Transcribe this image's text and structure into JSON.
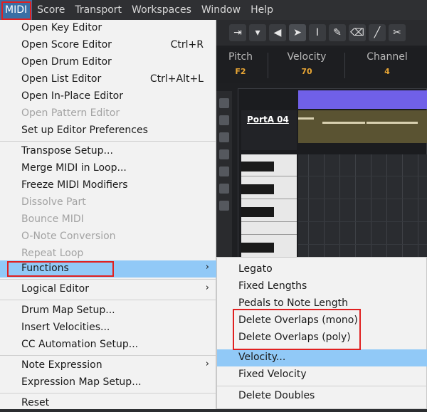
{
  "menubar": {
    "items": [
      "MIDI",
      "Score",
      "Transport",
      "Workspaces",
      "Window",
      "Help"
    ]
  },
  "infobar": {
    "pitch_label": "Pitch",
    "pitch_value": "F2",
    "velocity_label": "Velocity",
    "velocity_value": "70",
    "channel_label": "Channel",
    "channel_value": "4"
  },
  "track": {
    "name": "PortA 04"
  },
  "midi_menu": {
    "items": [
      {
        "label": "Open Key Editor",
        "shortcut": "",
        "disabled": false
      },
      {
        "label": "Open Score Editor",
        "shortcut": "Ctrl+R",
        "disabled": false
      },
      {
        "label": "Open Drum Editor",
        "shortcut": "",
        "disabled": false
      },
      {
        "label": "Open List Editor",
        "shortcut": "Ctrl+Alt+L",
        "disabled": false
      },
      {
        "label": "Open In-Place Editor",
        "shortcut": "",
        "disabled": false
      },
      {
        "label": "Open Pattern Editor",
        "shortcut": "",
        "disabled": true
      },
      {
        "label": "Set up Editor Preferences",
        "shortcut": "",
        "disabled": false
      },
      {
        "label": "Transpose Setup...",
        "shortcut": "",
        "disabled": false
      },
      {
        "label": "Merge MIDI in Loop...",
        "shortcut": "",
        "disabled": false
      },
      {
        "label": "Freeze MIDI Modifiers",
        "shortcut": "",
        "disabled": false
      },
      {
        "label": "Dissolve Part",
        "shortcut": "",
        "disabled": true
      },
      {
        "label": "Bounce MIDI",
        "shortcut": "",
        "disabled": true
      },
      {
        "label": "O-Note Conversion",
        "shortcut": "",
        "disabled": true
      },
      {
        "label": "Repeat Loop",
        "shortcut": "",
        "disabled": true
      },
      {
        "label": "Functions",
        "shortcut": "",
        "disabled": false
      },
      {
        "label": "Logical Editor",
        "shortcut": "",
        "disabled": false
      },
      {
        "label": "Drum Map Setup...",
        "shortcut": "",
        "disabled": false
      },
      {
        "label": "Insert Velocities...",
        "shortcut": "",
        "disabled": false
      },
      {
        "label": "CC Automation Setup...",
        "shortcut": "",
        "disabled": false
      },
      {
        "label": "Note Expression",
        "shortcut": "",
        "disabled": false
      },
      {
        "label": "Expression Map Setup...",
        "shortcut": "",
        "disabled": false
      },
      {
        "label": "Reset",
        "shortcut": "",
        "disabled": false
      }
    ],
    "submenu_arrow": "›"
  },
  "functions_submenu": {
    "items": [
      "Legato",
      "Fixed Lengths",
      "Pedals to Note Length",
      "Delete Overlaps (mono)",
      "Delete Overlaps (poly)",
      "Velocity...",
      "Fixed Velocity",
      "Delete Doubles"
    ]
  },
  "colors": {
    "highlight": "#91c9f7",
    "annotation": "#e02020",
    "ruler": "#7060e8",
    "value_text": "#e8a534"
  }
}
